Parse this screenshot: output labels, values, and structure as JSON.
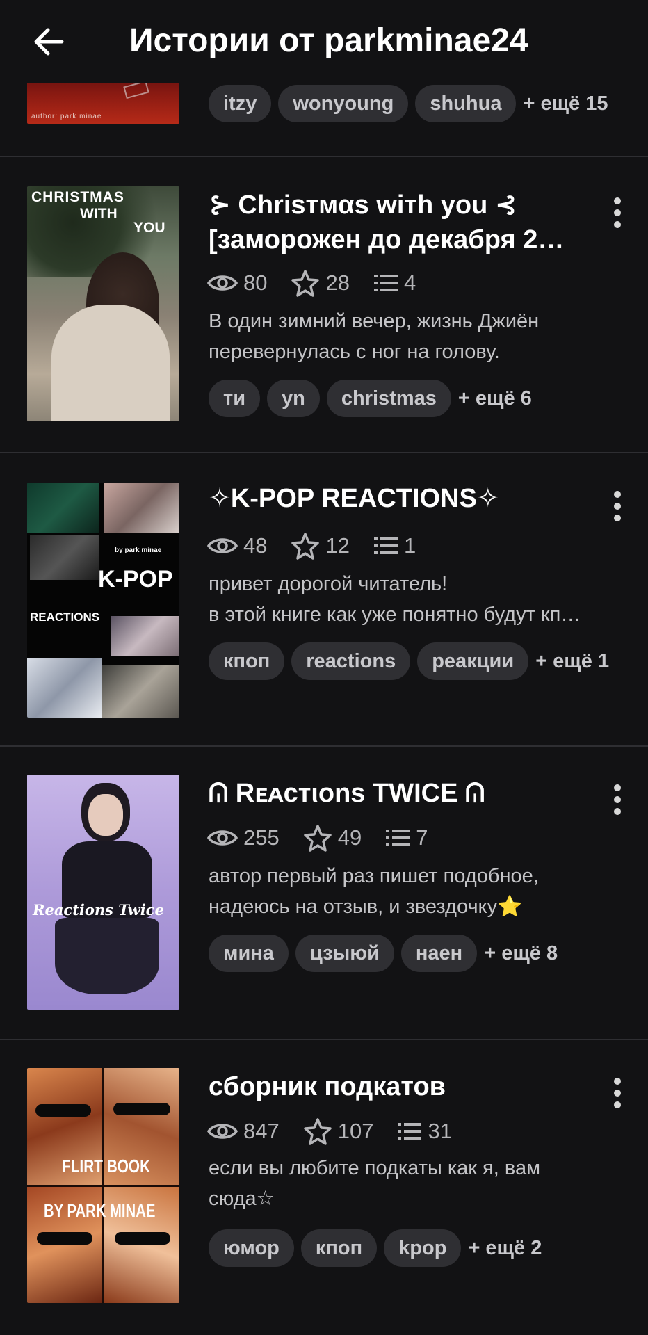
{
  "header": {
    "title": "Истории от parkminae24"
  },
  "stories": [
    {
      "cover_text": "author: park minae",
      "tags": [
        "itzy",
        "wonyoung",
        "shuhua"
      ],
      "more": "+ ещё 15"
    },
    {
      "title": "⊱ Chrisтмαs wiтh you ⊰ [заморожен до декабря 2…",
      "views": "80",
      "stars": "28",
      "parts": "4",
      "desc": [
        "В один зимний вечер, жизнь Джиён",
        "перевернулась с ног на голову."
      ],
      "tags": [
        "ти",
        "yn",
        "christmas"
      ],
      "more": "+ ещё 6",
      "cover_text": [
        "CHRISTMAS",
        "WITH",
        "YOU"
      ]
    },
    {
      "title": "✧K-POP REACTIONS✧",
      "views": "48",
      "stars": "12",
      "parts": "1",
      "desc": [
        "привет дорогой читатель!",
        "в этой книге как уже понятно будут кп…"
      ],
      "tags": [
        "кпоп",
        "reactions",
        "реакции"
      ],
      "more": "+ ещё 1",
      "cover_text": [
        "by park minae",
        "K-POP",
        "REACTIONS"
      ]
    },
    {
      "title": "ᕬ Rᴇᴀcтιons TWICE ᕬ",
      "views": "255",
      "stars": "49",
      "parts": "7",
      "desc": [
        "автор первый раз пишет подобное,",
        "надеюсь на отзыв, и звездочку⭐"
      ],
      "tags": [
        "мина",
        "цзыюй",
        "наен"
      ],
      "more": "+ ещё 8",
      "cover_text": [
        "Reactions Twice"
      ]
    },
    {
      "title": "сборник подкатов",
      "views": "847",
      "stars": "107",
      "parts": "31",
      "desc": [
        "если вы любите подкаты как я, вам",
        "сюда☆"
      ],
      "tags": [
        "юмор",
        "кпоп",
        "kpop"
      ],
      "more": "+ ещё 2",
      "cover_text": [
        "FLIRT BOOK",
        "BY PARK MINAE"
      ]
    }
  ],
  "colors": {
    "background": "#121214",
    "tag_bg": "#2f2f33",
    "divider": "#2e2e32",
    "muted_text": "#b5b5b8"
  },
  "icons": {
    "back": "arrow-left-icon",
    "views": "eye-icon",
    "stars": "star-outline-icon",
    "parts": "list-icon",
    "menu": "more-vertical-icon"
  }
}
